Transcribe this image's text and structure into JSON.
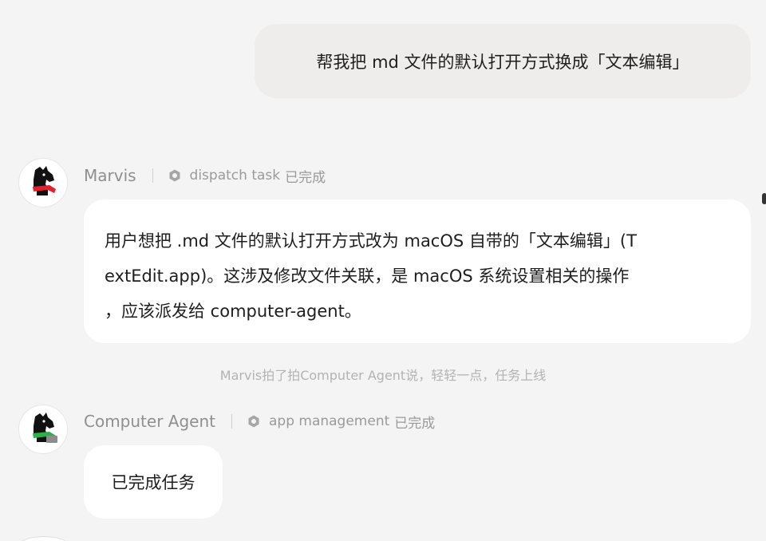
{
  "user_message": {
    "text": "帮我把 md 文件的默认打开方式换成「文本编辑」"
  },
  "marvis": {
    "name": "Marvis",
    "task_icon": "hexagon-nut-icon",
    "task_label": "dispatch task",
    "task_status": "已完成",
    "message_lines": [
      "用户想把 .md 文件的默认打开方式改为 macOS 自带的「文本编辑」(T",
      "extEdit.app)。这涉及修改文件关联，是 macOS 系统设置相关的操作",
      "，应该派发给 computer-agent。"
    ]
  },
  "system_note": "Marvis拍了拍Computer Agent说，轻轻一点，任务上线",
  "computer_agent": {
    "name": "Computer Agent",
    "task_icon": "hexagon-nut-icon",
    "task_label": "app management",
    "task_status": "已完成",
    "message": "已完成任务"
  },
  "colors": {
    "background": "#f4f4f4",
    "user_bubble": "#efedeb",
    "assistant_bubble": "#ffffff",
    "marvis_scarf": "#e0202a",
    "agent_scarf": "#2bb04a"
  }
}
